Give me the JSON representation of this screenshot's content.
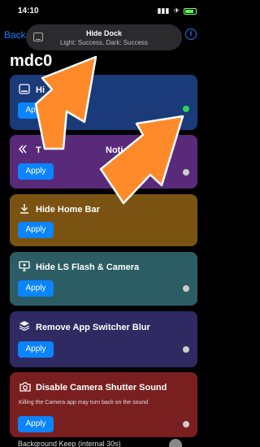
{
  "status_bar": {
    "time": "14:10",
    "signal_icon": "signal-icon",
    "airplane_icon": "airplane-icon",
    "battery_icon": "battery-icon"
  },
  "nav": {
    "back_label": "Back",
    "info_icon": "info-icon"
  },
  "toast": {
    "title": "Hide Dock",
    "subtitle": "Light: Success, Dark: Success",
    "icon": "dock-icon"
  },
  "app": {
    "title": "mdc0"
  },
  "apply_label": "Apply",
  "cards": [
    {
      "title": "Hi",
      "icon": "dock-icon",
      "color": "#1a3a7a",
      "enabled": true
    },
    {
      "title": "T",
      "title_tail": "Noti & Med",
      "icon": "chevrons-icon",
      "color": "#5a2a7a",
      "enabled": false
    },
    {
      "title": "Hide Home Bar",
      "icon": "download-arrow-icon",
      "color": "#7a5212",
      "enabled": false
    },
    {
      "title": "Hide LS Flash & Camera",
      "icon": "screen-icon",
      "color": "#2c5c64",
      "enabled": false
    },
    {
      "title": "Remove App Switcher Blur",
      "icon": "layers-icon",
      "color": "#2f2a62",
      "enabled": false
    },
    {
      "title": "Disable Camera Shutter Sound",
      "icon": "camera-icon",
      "color": "#7a1f1f",
      "enabled": false,
      "description": "Killing the Camera app may turn back on the sound"
    }
  ],
  "last_row": {
    "label": "Background Keep (internal 30s)"
  },
  "colors": {
    "accent": "#0a84ff",
    "enabled_dot": "#30d158",
    "arrow": "#ff8a2a"
  }
}
